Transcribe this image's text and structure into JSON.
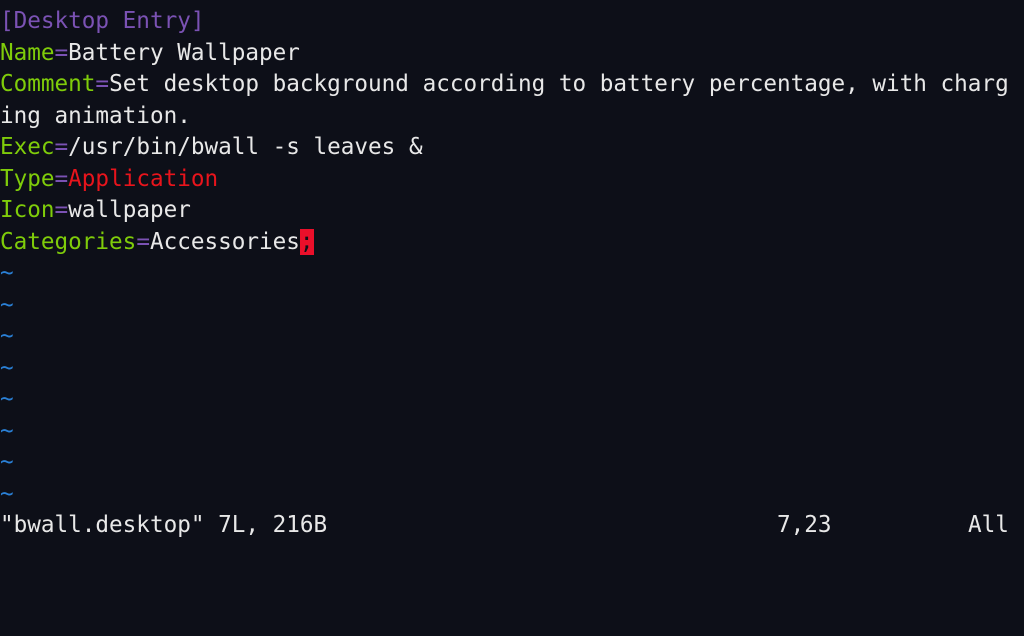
{
  "editor": "vim",
  "buffer": {
    "section": "[Desktop Entry]",
    "entries": [
      {
        "key": "Name",
        "value": "Battery Wallpaper"
      },
      {
        "key": "Comment",
        "value": "Set desktop background according to battery percentage, with charging animation."
      },
      {
        "key": "Exec",
        "value": "/usr/bin/bwall -s leaves &"
      },
      {
        "key": "Type",
        "value": "Application"
      },
      {
        "key": "Icon",
        "value": "wallpaper"
      },
      {
        "key": "Categories",
        "value": "Accessories",
        "cursor_char": ";"
      }
    ],
    "separator": "=",
    "empty_line_marker": "~"
  },
  "status_line": {
    "file_info": "\"bwall.desktop\" 7L, 216B",
    "position": "7,23",
    "scroll": "All"
  },
  "colors": {
    "background": "#0d0f18",
    "key": "#7fcc0a",
    "section": "#7b52b4",
    "type_value": "#e8141c",
    "tilde": "#2a80d6",
    "cursor": "#ea0f2a"
  }
}
